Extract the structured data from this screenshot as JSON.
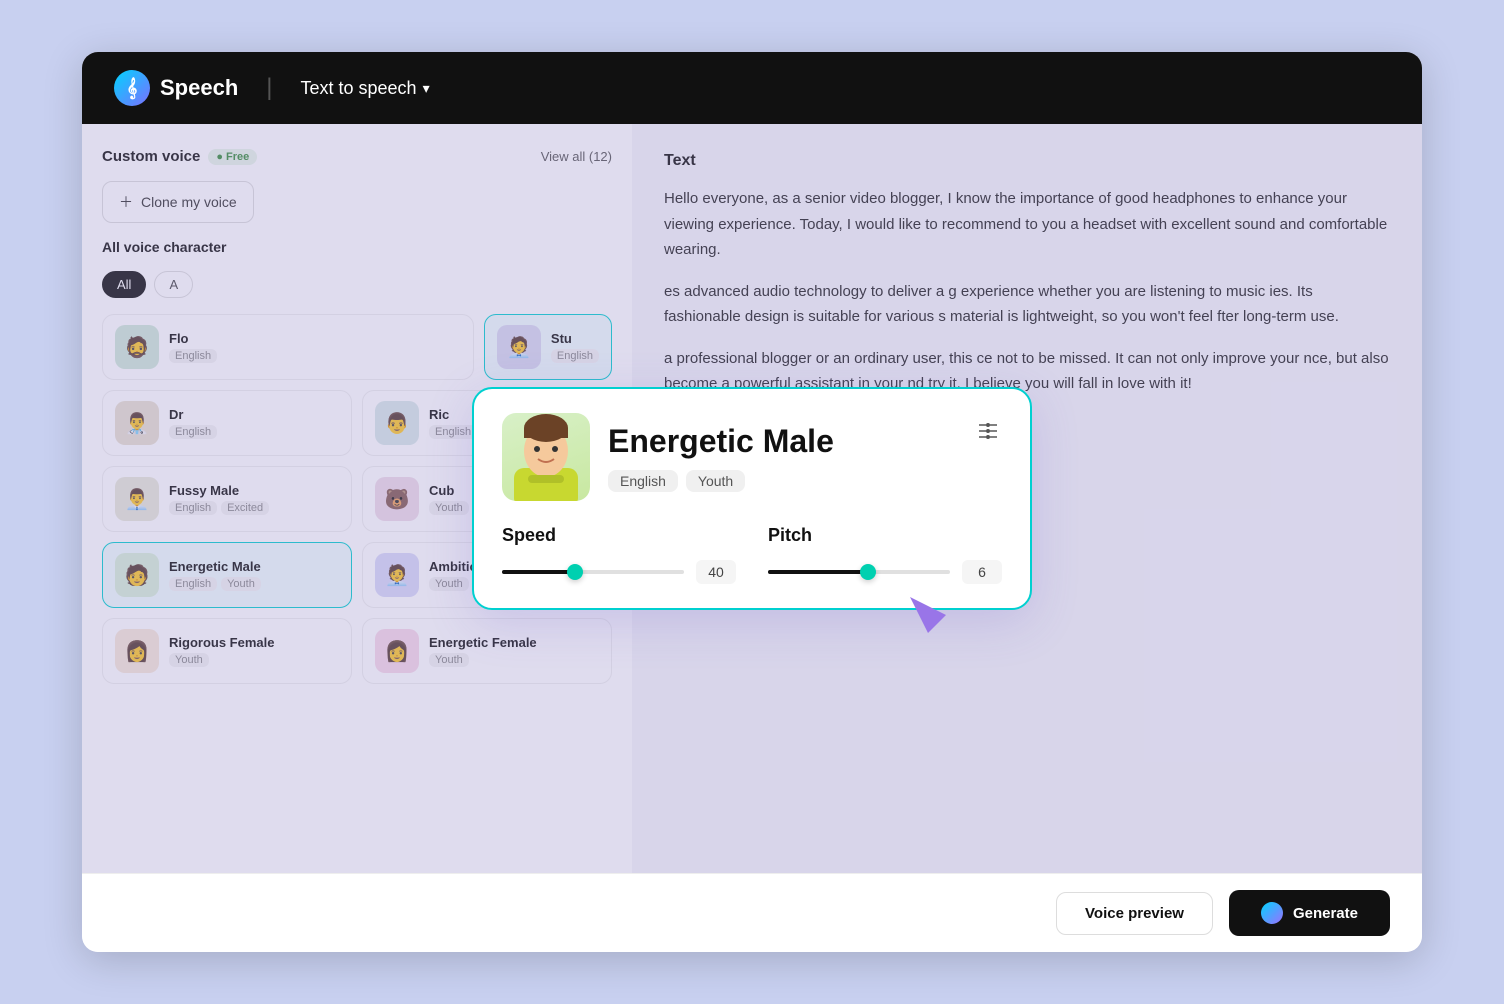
{
  "header": {
    "logo_text": "Speech",
    "nav_label": "Text to speech",
    "nav_chevron": "▾"
  },
  "sidebar": {
    "custom_voice_label": "Custom voice",
    "free_badge": "● Free",
    "view_all_label": "View all (12)",
    "clone_btn_label": "Clone my voice",
    "section_title": "All voice character",
    "filters": [
      "All",
      "A"
    ],
    "voices": [
      {
        "id": "flo",
        "name": "Flo",
        "tags": [
          "English",
          ""
        ],
        "avatar": "👨",
        "selected": false
      },
      {
        "id": "stu",
        "name": "Stu",
        "tags": [
          "English",
          ""
        ],
        "avatar": "👨",
        "selected": true
      },
      {
        "id": "dr",
        "name": "Dr",
        "tags": [
          "English",
          ""
        ],
        "avatar": "🧔",
        "selected": false
      },
      {
        "id": "ric",
        "name": "Ric",
        "tags": [
          "English",
          ""
        ],
        "avatar": "👨",
        "selected": false
      },
      {
        "id": "fussy-male",
        "name": "Fussy Male",
        "tags": [
          "English",
          "Excited"
        ],
        "avatar": "👨‍💼",
        "selected": false
      },
      {
        "id": "cub",
        "name": "Cub",
        "tags": [
          "Youth"
        ],
        "avatar": "🐻",
        "selected": false
      },
      {
        "id": "energetic-male",
        "name": "Energetic Male",
        "tags": [
          "English",
          "Youth"
        ],
        "avatar": "🧑",
        "selected": true
      },
      {
        "id": "ambitious-male",
        "name": "Ambitious Male",
        "tags": [
          "Youth"
        ],
        "avatar": "🧑‍💼",
        "selected": false
      },
      {
        "id": "rigorous-female",
        "name": "Rigorous Female",
        "tags": [
          "Youth"
        ],
        "avatar": "👩",
        "selected": false
      },
      {
        "id": "energetic-female",
        "name": "Energetic Female",
        "tags": [
          "Youth"
        ],
        "avatar": "👩",
        "selected": false
      }
    ]
  },
  "text_panel": {
    "label": "Text",
    "paragraphs": [
      "Hello everyone, as a senior video blogger, I know the importance of good headphones to enhance your viewing experience. Today, I would like to recommend to you a headset with excellent sound and comfortable wearing.",
      "es advanced audio technology to deliver a g experience whether you are listening to music ies. Its fashionable design is suitable for various s material is lightweight, so you won't feel fter long-term use.",
      "a professional blogger or an ordinary user, this ce not to be missed. It can not only improve your nce, but also become a powerful assistant in your nd try it, I believe you will fall in love with it!"
    ]
  },
  "bottom_bar": {
    "voice_preview_label": "Voice preview",
    "generate_label": "Generate"
  },
  "popup": {
    "voice_name": "Energetic Male",
    "tags": [
      "English",
      "Youth"
    ],
    "settings_icon": "⚙",
    "speed_label": "Speed",
    "speed_value": "40",
    "speed_percent": 40,
    "pitch_label": "Pitch",
    "pitch_value": "6",
    "pitch_percent": 55
  }
}
